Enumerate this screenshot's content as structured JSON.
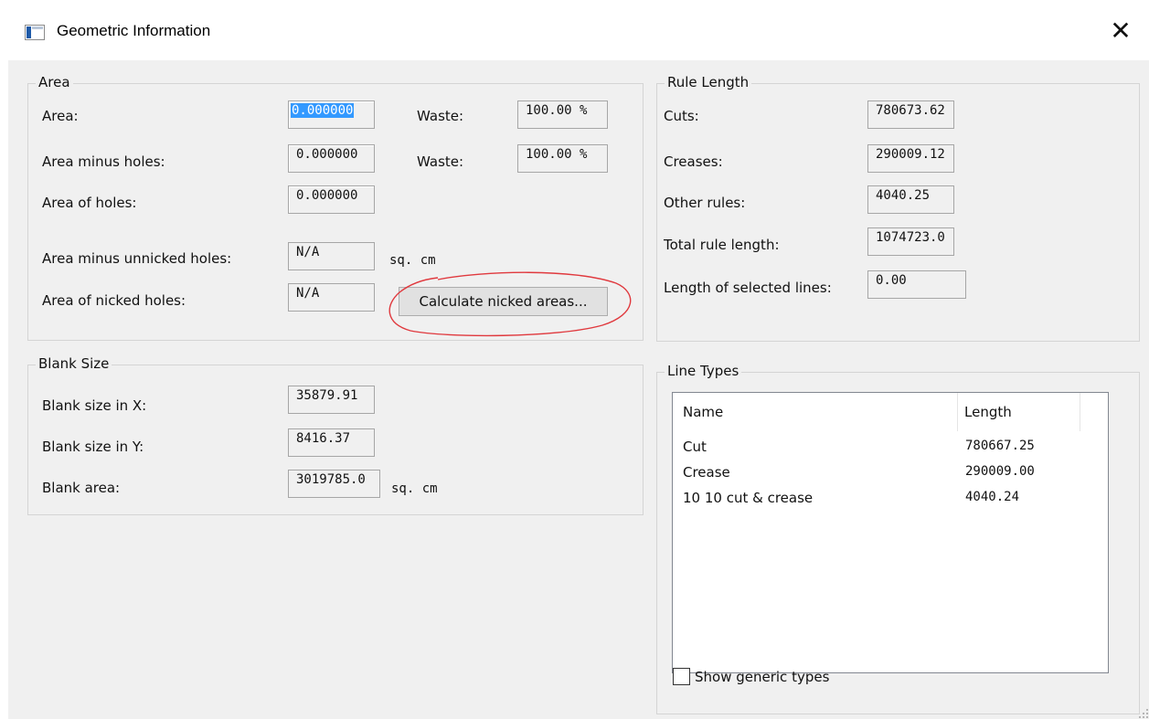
{
  "window": {
    "title": "Geometric Information",
    "close_glyph": "✕"
  },
  "area": {
    "group_label": "Area",
    "area_label": "Area:",
    "area_value": "0.000000",
    "waste1_label": "Waste:",
    "waste1_value": "100.00 %",
    "area_minus_holes_label": "Area minus holes:",
    "area_minus_holes_value": "0.000000",
    "waste2_label": "Waste:",
    "waste2_value": "100.00 %",
    "area_of_holes_label": "Area of holes:",
    "area_of_holes_value": "0.000000",
    "area_minus_unnicked_label": "Area minus unnicked holes:",
    "area_minus_unnicked_value": "N/A",
    "unit1": "sq. cm",
    "area_nicked_label": "Area of nicked holes:",
    "area_nicked_value": "N/A",
    "calculate_button": "Calculate nicked areas..."
  },
  "blank_size": {
    "group_label": "Blank Size",
    "x_label": "Blank size in X:",
    "x_value": "35879.91",
    "y_label": "Blank size in Y:",
    "y_value": "8416.37",
    "area_label": "Blank area:",
    "area_value": "3019785.0",
    "unit": "sq. cm"
  },
  "rule_length": {
    "group_label": "Rule Length",
    "cuts_label": "Cuts:",
    "cuts_value": "780673.62",
    "creases_label": "Creases:",
    "creases_value": "290009.12",
    "other_label": "Other rules:",
    "other_value": "4040.25",
    "total_label": "Total rule length:",
    "total_value": "1074723.0",
    "selected_label": "Length of selected lines:",
    "selected_value": "0.00"
  },
  "line_types": {
    "group_label": "Line Types",
    "columns": [
      "Name",
      "Length"
    ],
    "rows": [
      {
        "name": "Cut",
        "length": "780667.25"
      },
      {
        "name": "Crease",
        "length": "290009.00"
      },
      {
        "name": "10 10 cut & crease",
        "length": "4040.24"
      }
    ],
    "show_generic_label": "Show generic types",
    "show_generic_checked": false
  },
  "annotation": {
    "color": "#e0393e"
  }
}
